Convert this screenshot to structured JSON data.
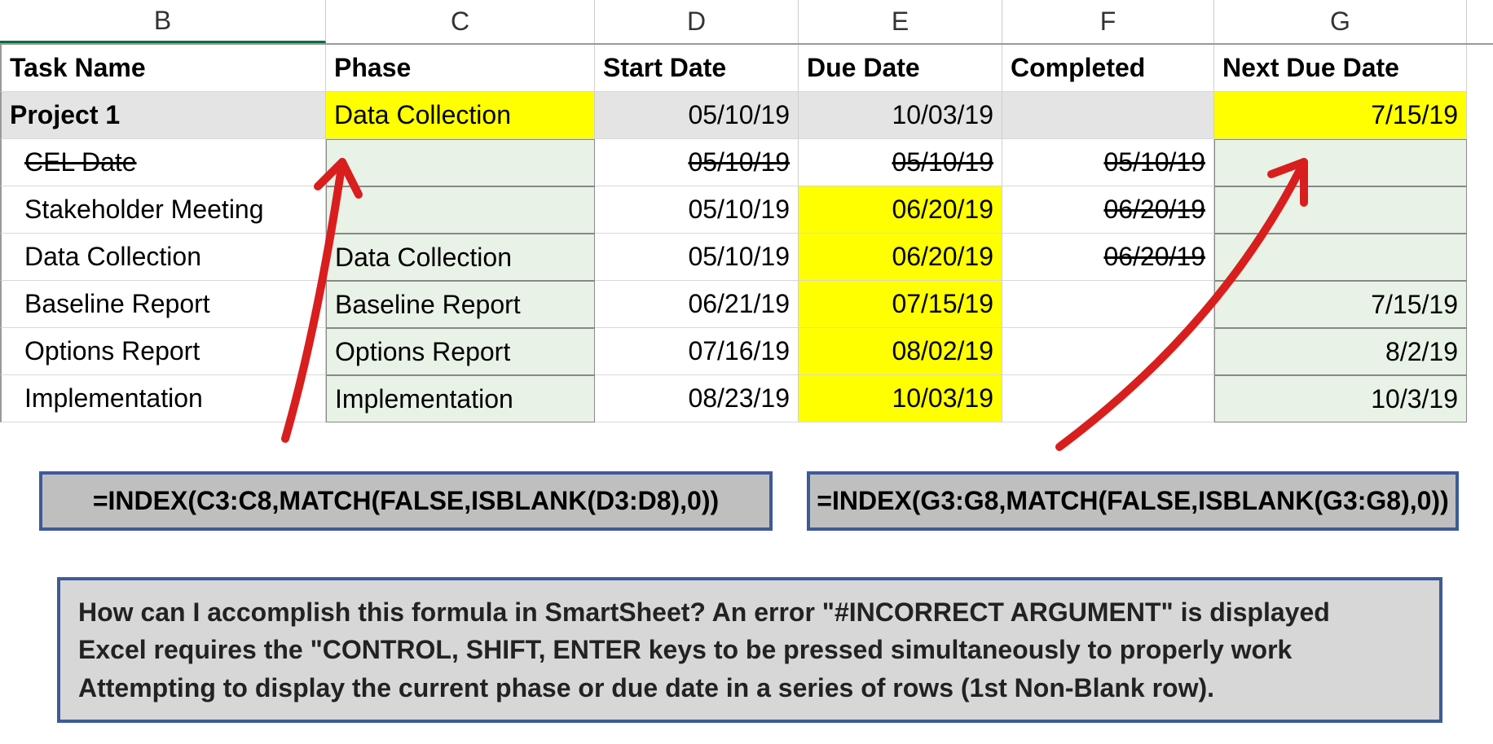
{
  "columns": {
    "b": "B",
    "c": "C",
    "d": "D",
    "e": "E",
    "f": "F",
    "g": "G"
  },
  "headers": {
    "task": "Task Name",
    "phase": "Phase",
    "start": "Start  Date",
    "due": "Due Date",
    "completed": "Completed",
    "next": "Next Due Date"
  },
  "summary": {
    "name": "Project 1",
    "phase": "Data Collection",
    "start": "05/10/19",
    "due": "10/03/19",
    "completed": "",
    "next": "7/15/19"
  },
  "rows": [
    {
      "task": "CEL Date",
      "phase": "",
      "start": "05/10/19",
      "due": "05/10/19",
      "completed": "05/10/19",
      "next": "",
      "strike_task": true,
      "strike_start": true,
      "strike_due": true,
      "strike_completed": true,
      "hl_due": false
    },
    {
      "task": "Stakeholder Meeting",
      "phase": "",
      "start": "05/10/19",
      "due": "06/20/19",
      "completed": "06/20/19",
      "next": "",
      "strike_completed": true,
      "hl_due": true
    },
    {
      "task": "Data Collection",
      "phase": "Data Collection",
      "start": "05/10/19",
      "due": "06/20/19",
      "completed": "06/20/19",
      "next": "",
      "strike_completed": true,
      "hl_due": true
    },
    {
      "task": "Baseline Report",
      "phase": "Baseline Report",
      "start": "06/21/19",
      "due": "07/15/19",
      "completed": "",
      "next": "7/15/19",
      "hl_due": true
    },
    {
      "task": "Options Report",
      "phase": "Options Report",
      "start": "07/16/19",
      "due": "08/02/19",
      "completed": "",
      "next": "8/2/19",
      "hl_due": true
    },
    {
      "task": "Implementation",
      "phase": "Implementation",
      "start": "08/23/19",
      "due": "10/03/19",
      "completed": "",
      "next": "10/3/19",
      "hl_due": true
    }
  ],
  "formulas": {
    "left": "=INDEX(C3:C8,MATCH(FALSE,ISBLANK(D3:D8),0))",
    "right": "=INDEX(G3:G8,MATCH(FALSE,ISBLANK(G3:G8),0))"
  },
  "question": {
    "line1": "How can I accomplish this formula in SmartSheet? An error \"#INCORRECT ARGUMENT\" is displayed",
    "line2": "Excel requires the \"CONTROL, SHIFT, ENTER keys to be pressed simultaneously to properly work",
    "line3": "Attempting to display the current phase or due date in a series of rows (1st Non-Blank row)."
  }
}
